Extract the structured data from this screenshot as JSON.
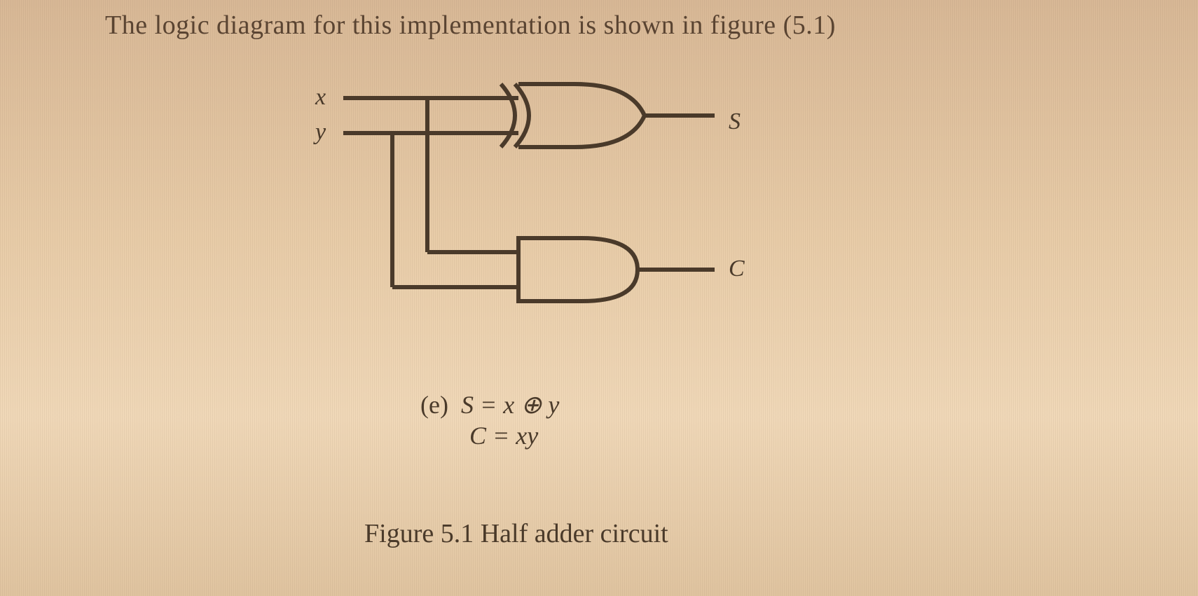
{
  "header": "The logic diagram for this implementation is shown in figure (5.1)",
  "inputs": {
    "x": "x",
    "y": "y"
  },
  "outputs": {
    "S": "S",
    "C": "C"
  },
  "equations": {
    "tag": "(e)",
    "line1": "S = x ⊕ y",
    "line2": "C = xy"
  },
  "caption": "Figure 5.1 Half adder circuit",
  "diagram_meta": {
    "gates": [
      {
        "type": "XOR",
        "inputs": [
          "x",
          "y"
        ],
        "output": "S"
      },
      {
        "type": "AND",
        "inputs": [
          "x",
          "y"
        ],
        "output": "C"
      }
    ]
  }
}
